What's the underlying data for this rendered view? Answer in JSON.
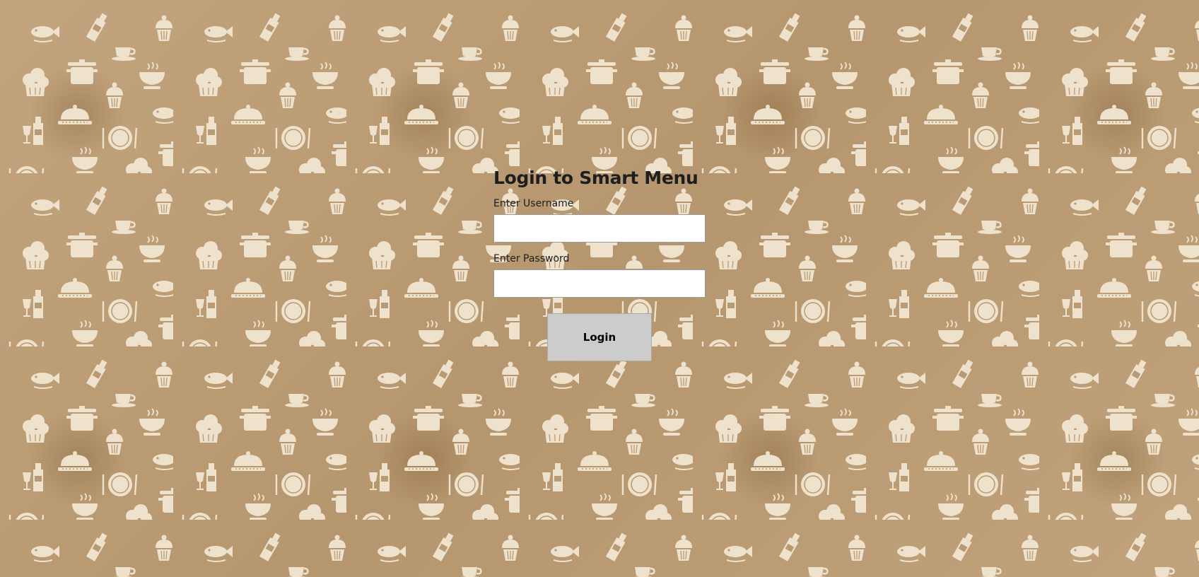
{
  "window": {
    "title": "Login to Smart Menu"
  },
  "form": {
    "username_label": "Enter Username",
    "username_value": "",
    "password_label": "Enter Password",
    "password_value": "",
    "login_label": "Login"
  },
  "background": {
    "pattern_icons": [
      "fish-icon",
      "wine-bottle-icon",
      "wine-glass-icon",
      "cupcake-icon",
      "chef-hat-icon",
      "cloche-icon",
      "cooking-pot-icon",
      "teacup-icon",
      "plate-cutlery-icon",
      "steaming-bowl-icon"
    ]
  },
  "colors": {
    "background": "#b89a74",
    "pattern_icon": "#efe2cc",
    "button": "#cccccc",
    "text": "#1e1e1e"
  }
}
